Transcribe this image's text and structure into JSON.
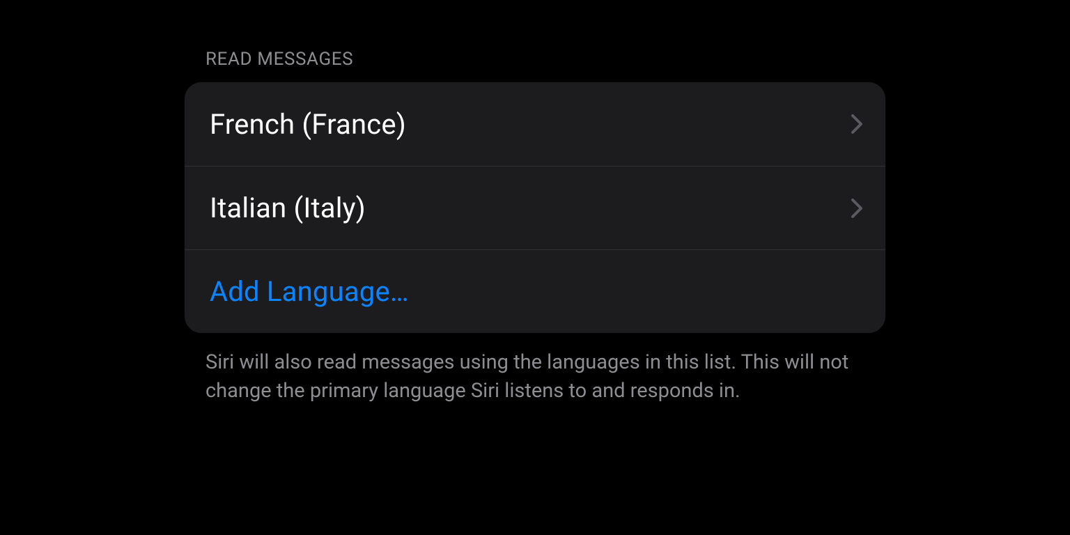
{
  "section": {
    "header": "READ MESSAGES",
    "languages": [
      {
        "label": "French (France)"
      },
      {
        "label": "Italian (Italy)"
      }
    ],
    "add_language_label": "Add Language…",
    "footer": "Siri will also read messages using the languages in this list. This will not change the primary language Siri listens to and responds in."
  },
  "colors": {
    "background": "#000000",
    "cell": "#1c1c1e",
    "separator": "#323235",
    "primaryText": "#ffffff",
    "secondaryText": "#8d8d92",
    "link": "#0a84ff"
  }
}
